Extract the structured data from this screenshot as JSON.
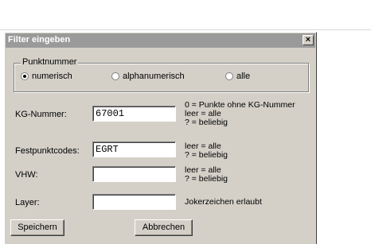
{
  "dialog": {
    "title": "Filter eingeben",
    "close_glyph": "×"
  },
  "group": {
    "legend": "Punktnummer",
    "options": [
      {
        "label": "numerisch",
        "checked": true
      },
      {
        "label": "alphanumerisch",
        "checked": false
      },
      {
        "label": "alle",
        "checked": false
      }
    ]
  },
  "fields": {
    "kg": {
      "label": "KG-Nummer:",
      "value": "67001",
      "hints": [
        "0 = Punkte ohne KG-Nummer",
        "leer = alle",
        "? = beliebig"
      ]
    },
    "festpunkt": {
      "label": "Festpunktcodes:",
      "value": "EGRT",
      "hints": [
        "leer = alle",
        "? = beliebig"
      ]
    },
    "vhw": {
      "label": "VHW:",
      "value": "",
      "hints": [
        "leer = alle",
        "? = beliebig"
      ]
    },
    "layer": {
      "label": "Layer:",
      "value": "",
      "hints": [
        "Jokerzeichen erlaubt"
      ]
    }
  },
  "buttons": {
    "save": "Speichern",
    "cancel": "Abbrechen"
  }
}
